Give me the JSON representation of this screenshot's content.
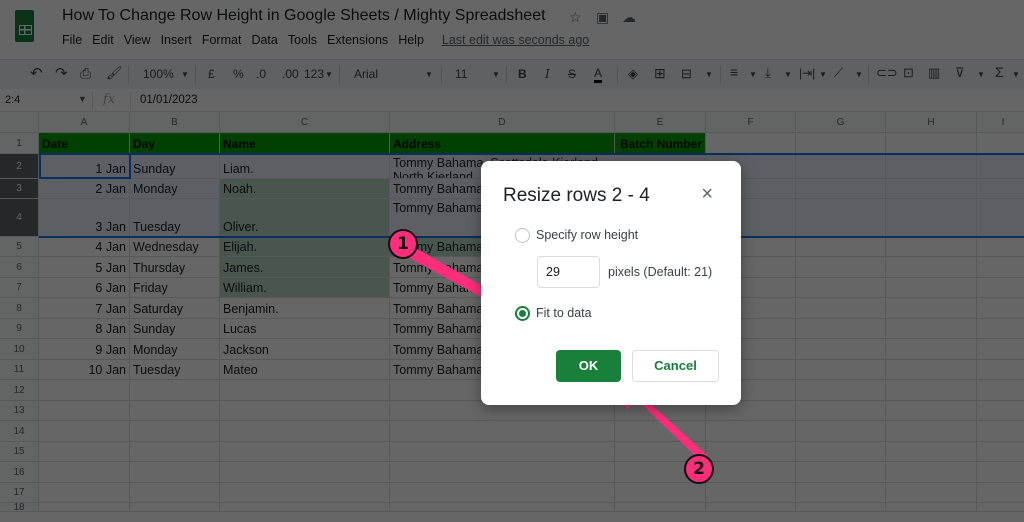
{
  "app": {
    "doc_title": "How To Change Row Height in Google Sheets / Mighty Spreadsheet",
    "title_icons": [
      "star-icon",
      "move-to-folder-icon",
      "cloud-status-icon"
    ],
    "menu": [
      "File",
      "Edit",
      "View",
      "Insert",
      "Format",
      "Data",
      "Tools",
      "Extensions",
      "Help"
    ],
    "last_edit": "Last edit was seconds ago"
  },
  "toolbar": {
    "zoom": "100%",
    "currency": "£",
    "percent": "%",
    "decrease_decimal": ".0",
    "increase_decimal": ".00",
    "more_formats": "123",
    "font": "Arial",
    "font_size": "11",
    "bold": "B",
    "italic": "I",
    "strike": "S",
    "text_color": "A"
  },
  "formula_bar": {
    "name_box": "2:4",
    "fx": "fx",
    "value": "01/01/2023"
  },
  "grid": {
    "columns": [
      "A",
      "B",
      "C",
      "D",
      "E",
      "F",
      "G",
      "H",
      "I"
    ],
    "rows": [
      "1",
      "2",
      "3",
      "4",
      "5",
      "6",
      "7",
      "8",
      "9",
      "10",
      "11",
      "12",
      "13",
      "14",
      "15",
      "16",
      "17",
      "18"
    ],
    "header": {
      "date": "Date",
      "day": "Day",
      "name": "Name",
      "address": "Address",
      "batch": "Batch Number"
    },
    "data": [
      {
        "date": "1 Jan",
        "day": "Sunday",
        "name": "Liam.",
        "address": "Tommy Bahama, Scottsdale Kierland North Kierland"
      },
      {
        "date": "2 Jan",
        "day": "Monday",
        "name": "Noah.",
        "address": "Tommy Bahama"
      },
      {
        "date": "3 Jan",
        "day": "Tuesday",
        "name": "Oliver.",
        "address": "Tommy Bahama E Buena Vista"
      },
      {
        "date": "4 Jan",
        "day": "Wednesday",
        "name": "Elijah.",
        "address": "Tommy Bahama"
      },
      {
        "date": "5 Jan",
        "day": "Thursday",
        "name": "James.",
        "address": "Tommy Bahama"
      },
      {
        "date": "6 Jan",
        "day": "Friday",
        "name": "William.",
        "address": "Tommy Bahama"
      },
      {
        "date": "7 Jan",
        "day": "Saturday",
        "name": "Benjamin.",
        "address": "Tommy Bahama"
      },
      {
        "date": "8 Jan",
        "day": "Sunday",
        "name": "Lucas",
        "address": "Tommy Bahama"
      },
      {
        "date": "9 Jan",
        "day": "Monday",
        "name": "Jackson",
        "address": "Tommy Bahama"
      },
      {
        "date": "10 Jan",
        "day": "Tuesday",
        "name": "Mateo",
        "address": "Tommy Bahama"
      }
    ]
  },
  "dialog": {
    "title": "Resize rows 2 - 4",
    "close": "×",
    "option_specify": "Specify row height",
    "option_fit": "Fit to data",
    "selected_option": "fit",
    "height_value": "29",
    "pixels_note": "pixels (Default: 21)",
    "ok": "OK",
    "cancel": "Cancel"
  },
  "annotations": {
    "step1": "1",
    "step2": "2",
    "color": "#ff2d7a"
  }
}
